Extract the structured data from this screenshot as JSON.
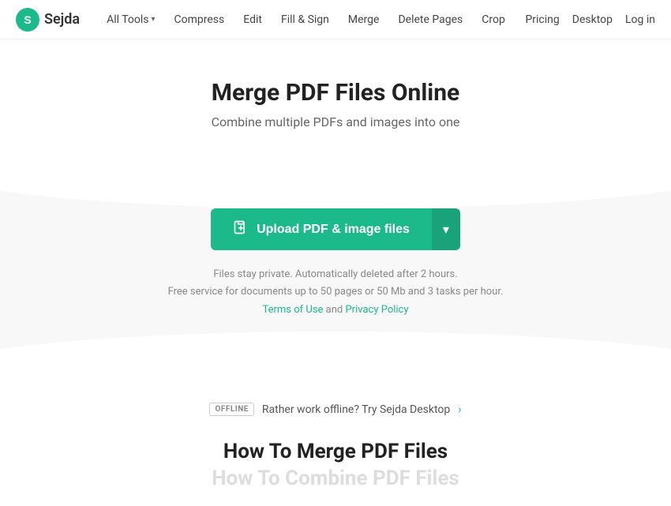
{
  "header": {
    "logo_text": "Sejda",
    "nav_items": [
      {
        "label": "All Tools",
        "has_dropdown": true
      },
      {
        "label": "Compress",
        "has_dropdown": false
      },
      {
        "label": "Edit",
        "has_dropdown": false
      },
      {
        "label": "Fill & Sign",
        "has_dropdown": false
      },
      {
        "label": "Merge",
        "has_dropdown": false
      },
      {
        "label": "Delete Pages",
        "has_dropdown": false
      },
      {
        "label": "Crop",
        "has_dropdown": false
      }
    ],
    "nav_right": [
      {
        "label": "Pricing"
      },
      {
        "label": "Desktop"
      },
      {
        "label": "Log in"
      }
    ]
  },
  "hero": {
    "title": "Merge PDF Files Online",
    "subtitle": "Combine multiple PDFs and images into one"
  },
  "upload": {
    "button_label": "Upload PDF & image files",
    "privacy_line1": "Files stay private. Automatically deleted after 2 hours.",
    "privacy_line2": "Free service for documents up to 50 pages or 50 Mb and 3 tasks per hour.",
    "terms_label": "Terms of Use",
    "and_text": "and",
    "privacy_label": "Privacy Policy"
  },
  "offline": {
    "badge_label": "OFFLINE",
    "text": "Rather work offline? Try Sejda Desktop",
    "arrow": "›"
  },
  "how_to": {
    "title": "How To Merge PDF Files",
    "subtitle": "How To Combine PDF Files"
  },
  "icons": {
    "upload": "📄",
    "chevron_down": "▾",
    "dropdown_arrow": "▾"
  }
}
